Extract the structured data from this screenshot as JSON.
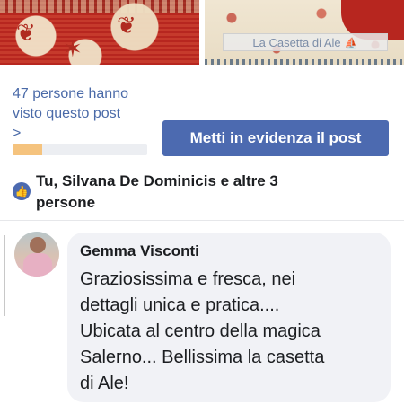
{
  "photos": {
    "watermark": "La Casetta di Ale"
  },
  "insights": {
    "views_line1": "47 persone hanno",
    "views_line2": "visto questo post",
    "chevron": ">",
    "progress_fraction": 0.22
  },
  "boost_button": {
    "label": "Metti in evidenza il post"
  },
  "reactions": {
    "names_line1": "Tu, Silvana De Dominicis e altre 3",
    "names_line2": "persone"
  },
  "comment": {
    "author": "Gemma Visconti",
    "text_lines": [
      "Graziosissima e fresca, nei",
      "dettagli unica e pratica....",
      "Ubicata al centro della magica",
      "Salerno... Bellissima la casetta",
      "di Ale!"
    ]
  },
  "colors": {
    "accent": "#4c6ab0",
    "link": "#4a6aa8",
    "progress": "#f5c37e"
  }
}
